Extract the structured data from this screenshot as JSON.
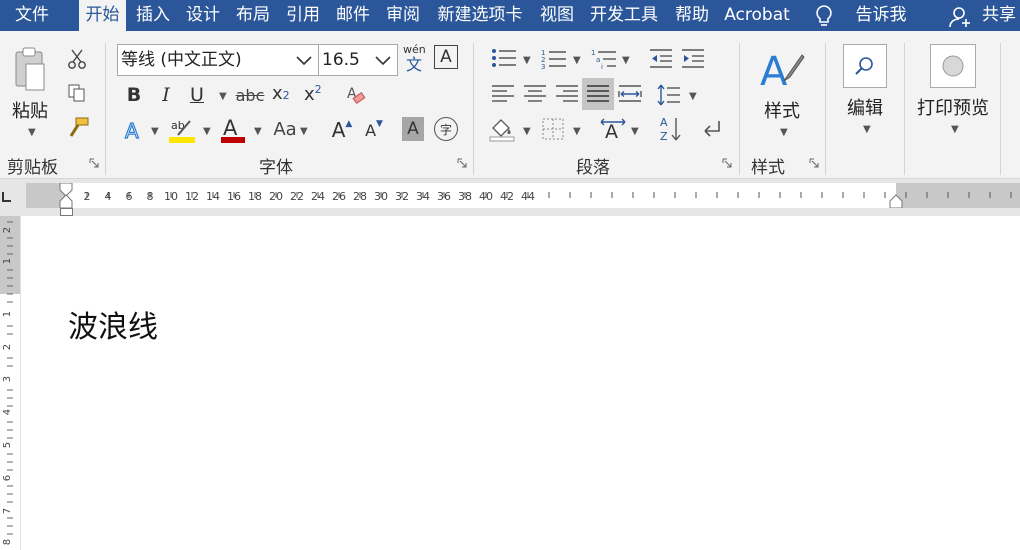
{
  "tabs": [
    {
      "label": "文件"
    },
    {
      "label": "开始"
    },
    {
      "label": "插入"
    },
    {
      "label": "设计"
    },
    {
      "label": "布局"
    },
    {
      "label": "引用"
    },
    {
      "label": "邮件"
    },
    {
      "label": "审阅"
    },
    {
      "label": "新建选项卡"
    },
    {
      "label": "视图"
    },
    {
      "label": "开发工具"
    },
    {
      "label": "帮助"
    },
    {
      "label": "Acrobat"
    }
  ],
  "tell_me": "告诉我",
  "share": "共享",
  "clipboard": {
    "paste_label": "粘贴",
    "group_label": "剪贴板"
  },
  "font": {
    "font_name": "等线 (中文正文)",
    "font_size": "16.5",
    "group_label": "字体",
    "phonetic_top": "wén",
    "phonetic_bottom": "文",
    "bold": "B",
    "italic": "I",
    "underline": "U",
    "strike": "abc",
    "subscript": "x",
    "superscript": "x",
    "case": "Aa",
    "grow": "A",
    "shrink": "A",
    "shade": "A",
    "enclose": "字",
    "highlight_color": "#ffe600",
    "font_color": "#c00000"
  },
  "paragraph": {
    "group_label": "段落"
  },
  "styles": {
    "label": "样式",
    "group_label": "样式"
  },
  "editing": {
    "label": "编辑"
  },
  "print": {
    "label": "打印预览"
  },
  "ruler": {
    "h_ticks": [
      "2",
      "4",
      "6",
      "8",
      "10",
      "12",
      "14",
      "16",
      "18",
      "20",
      "22",
      "24",
      "26",
      "28",
      "30",
      "32",
      "34",
      "36",
      "38",
      "40",
      "42",
      "44"
    ],
    "v_ticks": [
      "2",
      "1",
      "1",
      "2",
      "3",
      "4",
      "5",
      "6",
      "7",
      "8"
    ]
  },
  "document": {
    "text": "波浪线"
  },
  "colors": {
    "accent": "#2b579a",
    "ribbon_bg": "#f3f3f3"
  }
}
